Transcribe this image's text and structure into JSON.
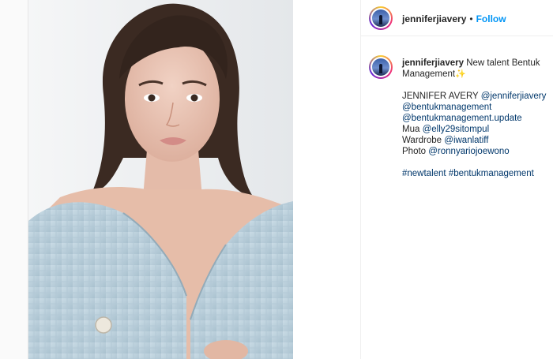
{
  "post": {
    "username": "jenniferjiavery",
    "separator": "•",
    "follow_label": "Follow",
    "caption_intro": "New talent Bentuk",
    "caption_intro_2": "Management",
    "caption_emoji": "✨",
    "lines": [
      {
        "text": "JENNIFER AVERY ",
        "mention": "@jenniferjiavery"
      },
      {
        "text": "",
        "mention": "@bentukmanagement"
      },
      {
        "text": "",
        "mention": "@bentukmanagement.update"
      },
      {
        "text": "Mua ",
        "mention": "@elly29sitompul"
      },
      {
        "text": "Wardrobe ",
        "mention": "@iwanlatiff"
      },
      {
        "text": "Photo ",
        "mention": "@ronnyariojoewono"
      }
    ],
    "hashtags": "#newtalent #bentukmanagement"
  },
  "icons": {
    "avatar": "profile-avatar-icon",
    "sparkle": "sparkle-emoji-icon"
  }
}
